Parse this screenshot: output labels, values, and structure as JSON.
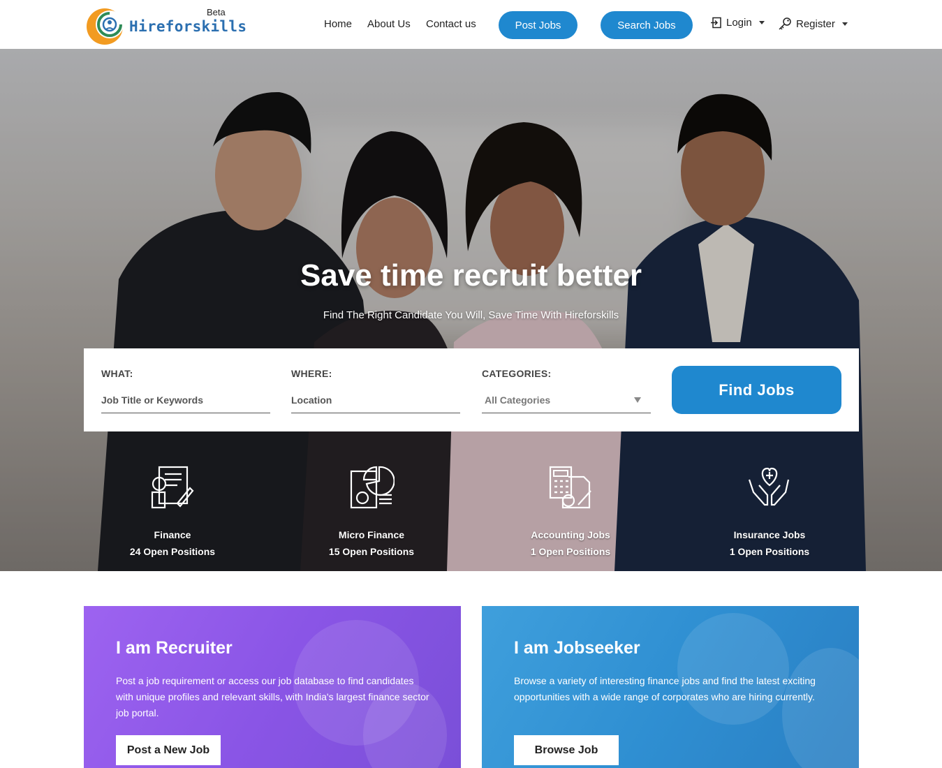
{
  "brand": {
    "name": "Hireforskills",
    "badge": "Beta",
    "colors": {
      "primary": "#1f88cf",
      "logo_text": "#2b6fb0",
      "logo_orange": "#f29b21"
    }
  },
  "nav": {
    "links": [
      "Home",
      "About Us",
      "Contact us"
    ],
    "post_jobs": "Post Jobs",
    "search_jobs": "Search Jobs",
    "login": "Login",
    "register": "Register"
  },
  "hero": {
    "title": "Save time recruit better",
    "subtitle": "Find The Right Candidate You Will, Save Time With Hireforskills"
  },
  "search": {
    "what_label": "WHAT:",
    "what_placeholder": "Job Title or Keywords",
    "where_label": "WHERE:",
    "where_placeholder": "Location",
    "category_label": "CATEGORIES:",
    "category_value": "All Categories",
    "submit": "Find Jobs"
  },
  "categories": [
    {
      "name": "Finance",
      "count": "24 Open Positions",
      "icon": "finance-document-icon"
    },
    {
      "name": "Micro Finance",
      "count": "15 Open Positions",
      "icon": "pie-chart-report-icon"
    },
    {
      "name": "Accounting Jobs",
      "count": "1 Open Positions",
      "icon": "calculator-invoice-icon"
    },
    {
      "name": "Insurance Jobs",
      "count": "1 Open Positions",
      "icon": "hands-heart-icon"
    }
  ],
  "cards": {
    "recruiter": {
      "title": "I am Recruiter",
      "text": "Post a job requirement or access our job database to find candidates with unique profiles and relevant skills, with India's largest finance sector job portal.",
      "button": "Post a New Job",
      "color": "#9d63f0"
    },
    "jobseeker": {
      "title": "I am Jobseeker",
      "text": "Browse a variety of interesting finance jobs and find the latest exciting opportunities with a wide range of corporates who are hiring currently.",
      "button": "Browse Job",
      "color": "#3f9fdc"
    }
  }
}
